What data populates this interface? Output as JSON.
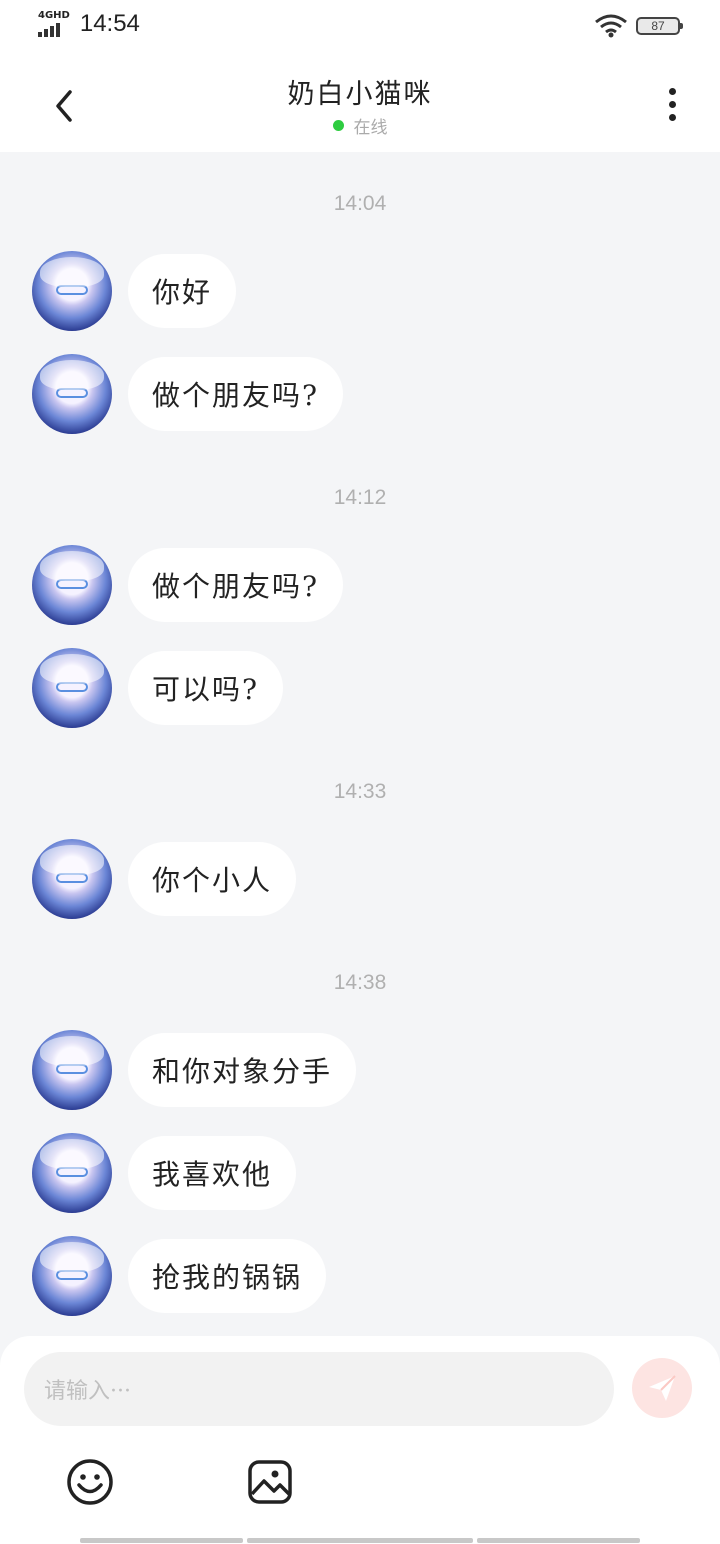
{
  "status_bar": {
    "network": "4GHD",
    "time": "14:54",
    "battery": "87"
  },
  "header": {
    "title": "奶白小猫咪",
    "status": "在线"
  },
  "colors": {
    "online": "#2ecc40",
    "send_button": "#fde4e2",
    "background": "#f4f5f7"
  },
  "timestamps": [
    "14:04",
    "14:12",
    "14:33",
    "14:38"
  ],
  "messages": [
    "你好",
    "做个朋友吗?",
    "做个朋友吗?",
    "可以吗?",
    "你个小人",
    "和你对象分手",
    "我喜欢他",
    "抢我的锅锅"
  ],
  "composer": {
    "placeholder": "请输入···"
  },
  "icons": [
    "back-arrow-icon",
    "more-vertical-icon",
    "send-icon",
    "emoji-icon",
    "image-icon",
    "wifi-icon",
    "signal-icon",
    "battery-icon"
  ]
}
